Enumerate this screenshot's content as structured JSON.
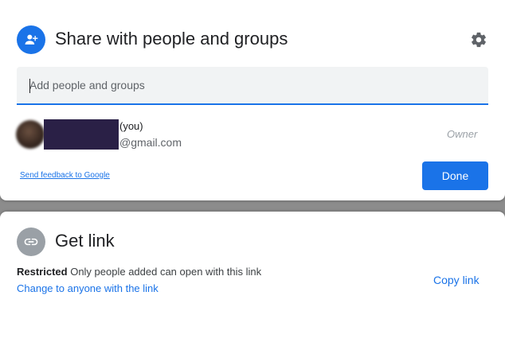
{
  "share": {
    "title": "Share with people and groups",
    "input_placeholder": "Add people and groups",
    "person": {
      "name_suffix": "(you)",
      "email_suffix": "@gmail.com",
      "role": "Owner"
    },
    "feedback_link": "Send feedback to Google",
    "done_label": "Done"
  },
  "get_link": {
    "title": "Get link",
    "access_level": "Restricted",
    "access_description": "Only people added can open with this link",
    "change_link": "Change to anyone with the link",
    "copy_link": "Copy link"
  },
  "icons": {
    "share": "person-add-icon",
    "settings": "gear-icon",
    "link": "link-icon"
  },
  "colors": {
    "accent": "#1a73e8",
    "link_icon_bg": "#9aa0a6",
    "owner_text": "#9aa0a6"
  }
}
